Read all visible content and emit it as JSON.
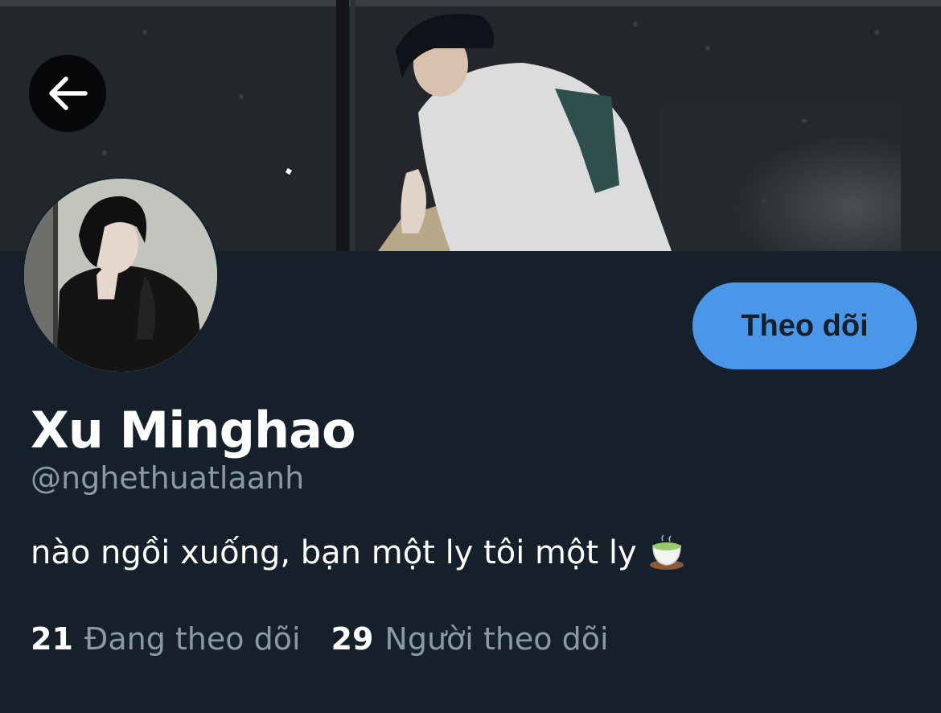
{
  "header": {
    "back_icon": "arrow-left-icon",
    "banner_image": "banner-photo"
  },
  "profile": {
    "avatar_image": "profile-avatar-photo",
    "display_name": "Xu Minghao",
    "handle": "@nghethuatlaanh",
    "bio": "nào ngồi xuống, bạn một ly tôi một ly",
    "bio_icon": "tea-cup-icon",
    "follow_label": "Theo dõi",
    "following_count": "21",
    "following_label": "Đang theo dõi",
    "followers_count": "29",
    "followers_label": "Người theo dõi"
  },
  "colors": {
    "background": "#15202b",
    "accent": "#4a96e8",
    "secondary_text": "#8b98a5"
  }
}
